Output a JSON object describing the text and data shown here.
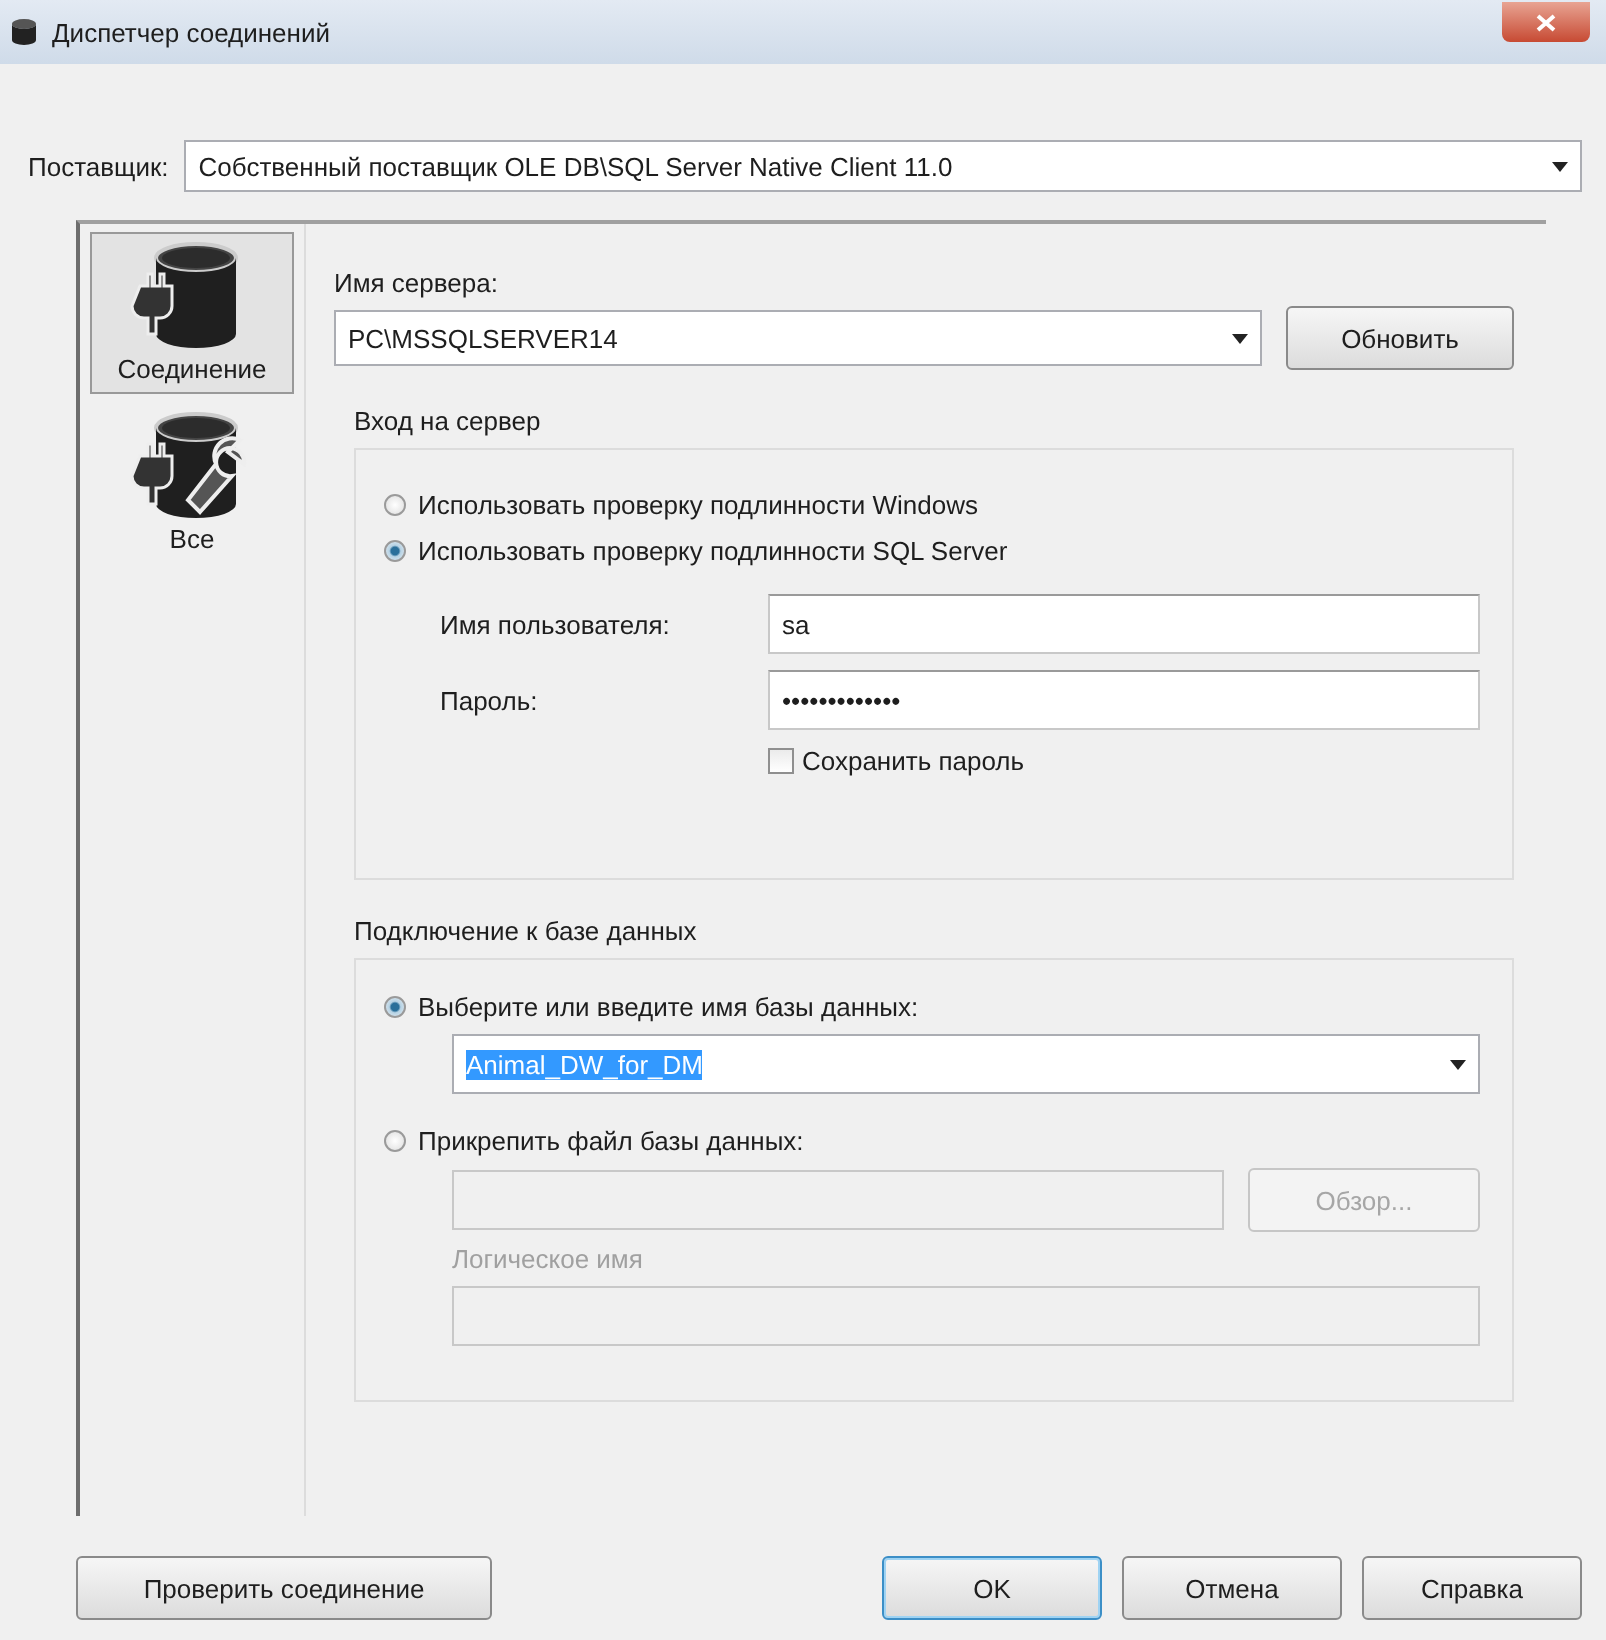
{
  "window": {
    "title": "Диспетчер соединений"
  },
  "provider": {
    "label": "Поставщик:",
    "value": "Собственный поставщик OLE DB\\SQL Server Native Client 11.0"
  },
  "sidebar": {
    "items": [
      {
        "label": "Соединение",
        "kind": "connection",
        "selected": true
      },
      {
        "label": "Все",
        "kind": "all",
        "selected": false
      }
    ]
  },
  "server": {
    "label": "Имя сервера:",
    "value": "PC\\MSSQLSERVER14",
    "refresh_button": "Обновить"
  },
  "login": {
    "title": "Вход на сервер",
    "options": [
      {
        "label": "Использовать проверку подлинности Windows",
        "selected": false
      },
      {
        "label": "Использовать проверку подлинности SQL Server",
        "selected": true
      }
    ],
    "username": {
      "label": "Имя пользователя:",
      "value": "sa"
    },
    "password": {
      "label": "Пароль:",
      "value": "•••••••••••••"
    },
    "save_password": {
      "label": "Сохранить пароль",
      "checked": false
    }
  },
  "database": {
    "title": "Подключение к базе данных",
    "options": [
      {
        "label": "Выберите или введите имя базы данных:",
        "selected": true
      },
      {
        "label": "Прикрепить файл базы данных:",
        "selected": false
      }
    ],
    "database_name": {
      "value": "Animal_DW_for_DM",
      "highlighted": true
    },
    "file_field": {
      "disabled": true
    },
    "browse_button": {
      "label": "Обзор...",
      "disabled": true
    },
    "logical_name": {
      "label": "Логическое имя",
      "disabled": true
    }
  },
  "buttons": [
    {
      "label": "Проверить соединение",
      "default": false
    },
    {
      "label": "OK",
      "default": true
    },
    {
      "label": "Отмена",
      "default": false
    },
    {
      "label": "Справка",
      "default": false
    }
  ]
}
